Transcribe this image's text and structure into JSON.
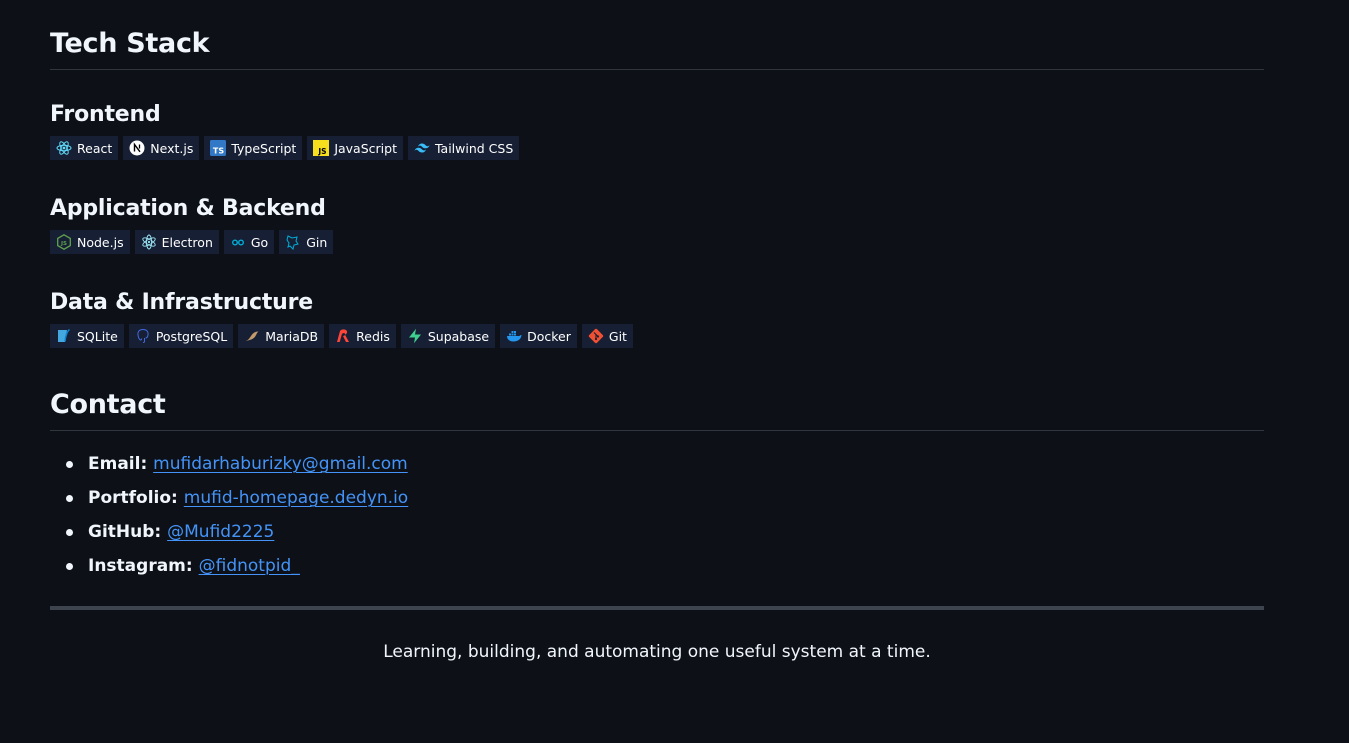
{
  "tech_stack": {
    "title": "Tech Stack",
    "groups": [
      {
        "title": "Frontend",
        "badges": [
          {
            "label": "React",
            "icon": "react-icon",
            "color": "#61dafb"
          },
          {
            "label": "Next.js",
            "icon": "nextjs-icon",
            "color": "#ffffff"
          },
          {
            "label": "TypeScript",
            "icon": "typescript-icon",
            "color": "#3178c6"
          },
          {
            "label": "JavaScript",
            "icon": "javascript-icon",
            "color": "#f7df1e"
          },
          {
            "label": "Tailwind CSS",
            "icon": "tailwind-icon",
            "color": "#38bdf8"
          }
        ]
      },
      {
        "title": "Application & Backend",
        "badges": [
          {
            "label": "Node.js",
            "icon": "nodejs-icon",
            "color": "#5fa04e"
          },
          {
            "label": "Electron",
            "icon": "electron-icon",
            "color": "#9feaf9"
          },
          {
            "label": "Go",
            "icon": "go-icon",
            "color": "#00add8"
          },
          {
            "label": "Gin",
            "icon": "gin-icon",
            "color": "#00add8"
          }
        ]
      },
      {
        "title": "Data & Infrastructure",
        "badges": [
          {
            "label": "SQLite",
            "icon": "sqlite-icon",
            "color": "#44a8e0"
          },
          {
            "label": "PostgreSQL",
            "icon": "postgresql-icon",
            "color": "#4169e1"
          },
          {
            "label": "MariaDB",
            "icon": "mariadb-icon",
            "color": "#c49a6c"
          },
          {
            "label": "Redis",
            "icon": "redis-icon",
            "color": "#ff4438"
          },
          {
            "label": "Supabase",
            "icon": "supabase-icon",
            "color": "#3fcf8e"
          },
          {
            "label": "Docker",
            "icon": "docker-icon",
            "color": "#2496ed"
          },
          {
            "label": "Git",
            "icon": "git-icon",
            "color": "#f05032"
          }
        ]
      }
    ]
  },
  "contact": {
    "title": "Contact",
    "items": [
      {
        "label": "Email:",
        "link": "mufidarhaburizky@gmail.com"
      },
      {
        "label": "Portfolio:",
        "link": "mufid-homepage.dedyn.io"
      },
      {
        "label": "GitHub:",
        "link": "@Mufid2225"
      },
      {
        "label": "Instagram:",
        "link": "@fidnotpid_"
      }
    ]
  },
  "footer": {
    "tagline": "Learning, building, and automating one useful system at a time."
  },
  "colors": {
    "background": "#0d1117",
    "badge_bg": "#161f33",
    "link": "#4493f8",
    "divider": "#30363d",
    "thick_rule": "#3d444d"
  }
}
